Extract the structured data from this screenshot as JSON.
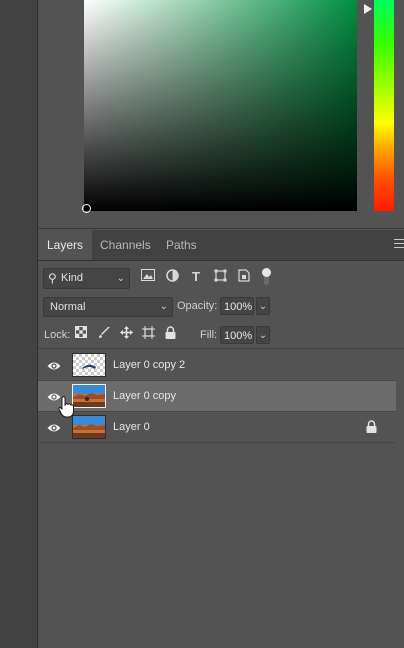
{
  "layers_panel": {
    "tabs": [
      {
        "label": "Layers",
        "active": true
      },
      {
        "label": "Channels",
        "active": false
      },
      {
        "label": "Paths",
        "active": false
      }
    ],
    "filter_kind": "Kind",
    "blend_mode": "Normal",
    "opacity_label": "Opacity:",
    "opacity_value": "100%",
    "lock_label": "Lock:",
    "fill_label": "Fill:",
    "fill_value": "100%",
    "layers": [
      {
        "name": "Layer 0 copy 2",
        "visible": true,
        "selected": false,
        "locked": false
      },
      {
        "name": "Layer 0 copy",
        "visible": true,
        "selected": true,
        "locked": false
      },
      {
        "name": "Layer 0",
        "visible": true,
        "selected": false,
        "locked": true
      }
    ]
  },
  "colors": {
    "panel_bg": "#535353",
    "tab_bar_bg": "#424242",
    "selected_row": "#6b6b6b",
    "picker_hue": "#008f3f"
  },
  "icons": {
    "filter": [
      "image-filter-icon",
      "adjustment-filter-icon",
      "type-filter-icon",
      "shape-filter-icon",
      "smart-object-filter-icon"
    ],
    "lock": [
      "lock-transparent-pixels-icon",
      "lock-image-pixels-icon",
      "lock-position-icon",
      "lock-artboard-icon",
      "lock-all-icon"
    ]
  }
}
